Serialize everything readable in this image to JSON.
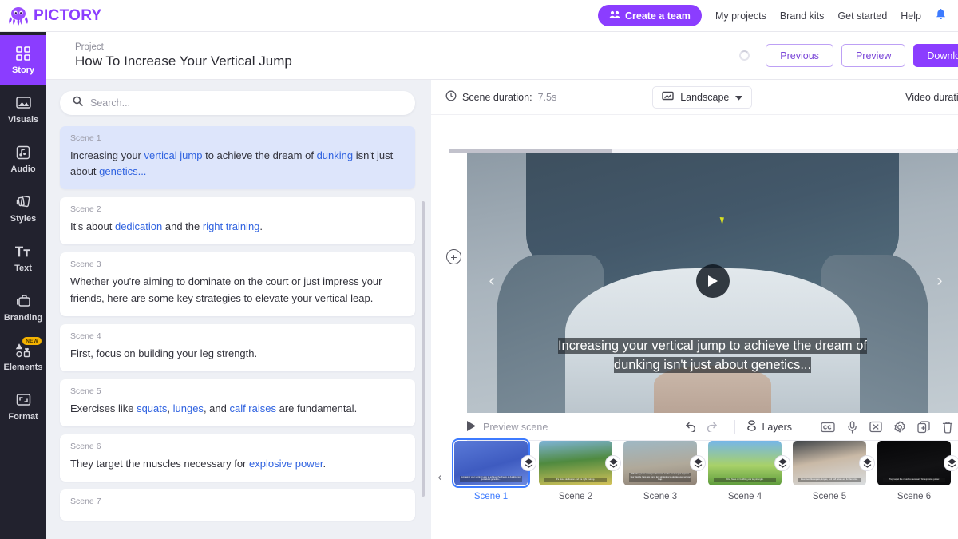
{
  "brand": {
    "name": "PICTORY",
    "logo_icon": "octopus-icon",
    "color": "#8B3DFF"
  },
  "topnav": {
    "create_team_label": "Create a team",
    "create_team_icon": "people-icon",
    "links": [
      {
        "label": "My projects"
      },
      {
        "label": "Brand kits"
      },
      {
        "label": "Get started"
      },
      {
        "label": "Help"
      }
    ],
    "bell_icon": "notification-bell-icon"
  },
  "sidebar": {
    "items": [
      {
        "label": "Story",
        "icon": "grid-squares-icon",
        "active": true,
        "badge": null
      },
      {
        "label": "Visuals",
        "icon": "image-icon",
        "active": false,
        "badge": null
      },
      {
        "label": "Audio",
        "icon": "music-note-icon",
        "active": false,
        "badge": null
      },
      {
        "label": "Styles",
        "icon": "layers-cards-icon",
        "active": false,
        "badge": null
      },
      {
        "label": "Text",
        "icon": "text-tt-icon",
        "active": false,
        "badge": null
      },
      {
        "label": "Branding",
        "icon": "briefcase-icon",
        "active": false,
        "badge": null
      },
      {
        "label": "Elements",
        "icon": "shapes-icon",
        "active": false,
        "badge": "NEW"
      },
      {
        "label": "Format",
        "icon": "crop-frame-icon",
        "active": false,
        "badge": null
      }
    ]
  },
  "project": {
    "label": "Project",
    "title": "How To Increase Your Vertical Jump",
    "previous_label": "Previous",
    "preview_label": "Preview",
    "download_label": "Download",
    "spinner_icon": "loading-spinner-icon"
  },
  "search": {
    "placeholder": "Search...",
    "value": "",
    "icon": "search-icon"
  },
  "scenes": [
    {
      "num": "Scene 1",
      "selected": true,
      "parts": [
        {
          "t": "Increasing your ",
          "kw": false
        },
        {
          "t": "vertical jump",
          "kw": true
        },
        {
          "t": " to achieve the dream of ",
          "kw": false
        },
        {
          "t": "dunking",
          "kw": true
        },
        {
          "t": " isn't just about ",
          "kw": false
        },
        {
          "t": "genetics...",
          "kw": true
        }
      ]
    },
    {
      "num": "Scene 2",
      "selected": false,
      "parts": [
        {
          "t": "It's about ",
          "kw": false
        },
        {
          "t": "dedication",
          "kw": true
        },
        {
          "t": " and the ",
          "kw": false
        },
        {
          "t": "right training",
          "kw": true
        },
        {
          "t": ".",
          "kw": false
        }
      ]
    },
    {
      "num": "Scene 3",
      "selected": false,
      "parts": [
        {
          "t": "Whether you're aiming to dominate on the court or just impress your friends, here are some key strategies to elevate your vertical leap.",
          "kw": false
        }
      ]
    },
    {
      "num": "Scene 4",
      "selected": false,
      "parts": [
        {
          "t": "First, focus on building your leg strength.",
          "kw": false
        }
      ]
    },
    {
      "num": "Scene 5",
      "selected": false,
      "parts": [
        {
          "t": "Exercises like ",
          "kw": false
        },
        {
          "t": "squats",
          "kw": true
        },
        {
          "t": ", ",
          "kw": false
        },
        {
          "t": "lunges",
          "kw": true
        },
        {
          "t": ", and ",
          "kw": false
        },
        {
          "t": "calf raises",
          "kw": true
        },
        {
          "t": " are fundamental.",
          "kw": false
        }
      ]
    },
    {
      "num": "Scene 6",
      "selected": false,
      "parts": [
        {
          "t": "They target the muscles necessary for ",
          "kw": false
        },
        {
          "t": "explosive power",
          "kw": true
        },
        {
          "t": ".",
          "kw": false
        }
      ]
    },
    {
      "num": "Scene 7",
      "selected": false,
      "parts": []
    }
  ],
  "editor": {
    "scene_duration_label": "Scene duration:",
    "scene_duration_value": "7.5s",
    "clock_icon": "clock-icon",
    "aspect_label": "Landscape",
    "aspect_icon": "landscape-frame-icon",
    "aspect_caret_icon": "chevron-down-icon",
    "video_duration_label": "Video duration:",
    "add_scene_icon": "plus-circle-icon",
    "prev_arrow_icon": "chevron-left-icon",
    "next_arrow_icon": "chevron-right-icon",
    "play_icon": "play-icon",
    "caption": {
      "line1": [
        {
          "t": "Increasing your ",
          "hl": false
        },
        {
          "t": "vertical jump",
          "hl": true
        },
        {
          "t": " to achieve the dream of",
          "hl": false
        }
      ],
      "line2": [
        {
          "t": "dunking",
          "hl": true
        },
        {
          "t": " isn't just about ",
          "hl": false
        },
        {
          "t": "genetics...",
          "hl": true
        }
      ]
    }
  },
  "toolbar": {
    "preview_scene_label": "Preview scene",
    "play_icon": "play-triangle-icon",
    "undo_icon": "undo-arrow-icon",
    "redo_icon": "redo-arrow-icon",
    "layers_label": "Layers",
    "layers_icon": "layers-icon",
    "icons": [
      {
        "name": "closed-caption-icon"
      },
      {
        "name": "microphone-icon"
      },
      {
        "name": "remove-background-icon"
      },
      {
        "name": "settings-gear-icon"
      },
      {
        "name": "duplicate-icon"
      },
      {
        "name": "trash-delete-icon"
      }
    ]
  },
  "thumbnails": {
    "prev_icon": "chevron-left-icon",
    "transition_icon": "transition-diamond-icon",
    "items": [
      {
        "label": "Scene 1",
        "selected": true,
        "caption": "Increasing your vertical jump to achieve the dream of dunking isn't just about genetics..."
      },
      {
        "label": "Scene 2",
        "selected": false,
        "caption": "It's about dedication and the right training."
      },
      {
        "label": "Scene 3",
        "selected": false,
        "caption": "Whether you're aiming to dominate on the court or just impress your friends, here are some key strategies to elevate your vertical leap."
      },
      {
        "label": "Scene 4",
        "selected": false,
        "caption": "First, focus on building your leg strength."
      },
      {
        "label": "Scene 5",
        "selected": false,
        "caption": "Exercises like squats, lunges, and calf raises are fundamental."
      },
      {
        "label": "Scene 6",
        "selected": false,
        "caption": "They target the muscles necessary for explosive power."
      }
    ]
  }
}
